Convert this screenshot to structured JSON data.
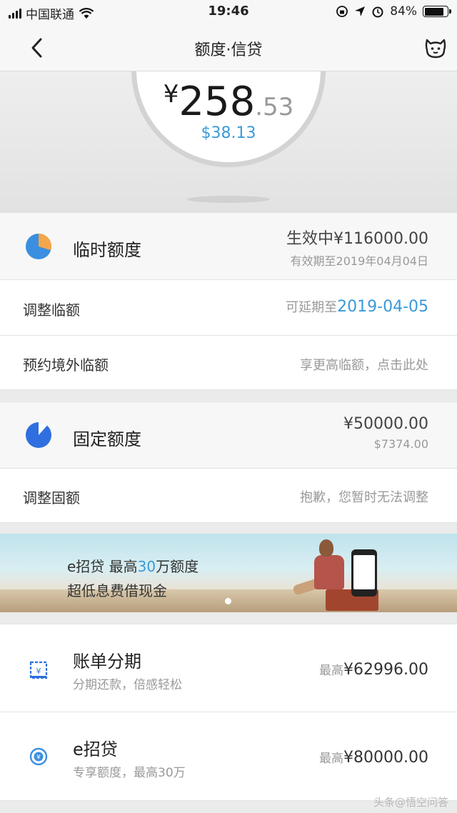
{
  "status_bar": {
    "carrier": "中国联通",
    "time": "19:46",
    "battery_percent": "84%",
    "battery_level": 0.84
  },
  "nav": {
    "title": "额度·信贷"
  },
  "hero": {
    "yen_symbol": "¥",
    "amount_int": "258",
    "amount_dec": ".53",
    "usd_amount": "$38.13"
  },
  "temporary_limit": {
    "label": "临时额度",
    "status_amount": "生效中¥116000.00",
    "validity": "有效期至2019年04月04日",
    "pie_color": "#3a8fe0",
    "pie_accent": "#f4a64a"
  },
  "adjust_temp": {
    "label": "调整临额",
    "hint_prefix": "可延期至",
    "hint_date": "2019-04-05"
  },
  "overseas_temp": {
    "label": "预约境外临额",
    "hint": "享更高临额，点击此处"
  },
  "fixed_limit": {
    "label": "固定额度",
    "amount": "¥50000.00",
    "usd": "$7374.00",
    "pie_color": "#2f6fe0"
  },
  "adjust_fixed": {
    "label": "调整固额",
    "hint": "抱歉，您暂时无法调整"
  },
  "banner": {
    "line1_prefix": "e招贷  最高",
    "line1_highlight": "30",
    "line1_suffix": "万额度",
    "line2": "超低息费借现金"
  },
  "products": [
    {
      "title": "账单分期",
      "subtitle": "分期还款，倍感轻松",
      "prefix": "最高",
      "amount": "¥62996.00"
    },
    {
      "title": "e招贷",
      "subtitle": "专享额度，最高30万",
      "prefix": "最高",
      "amount": "¥80000.00"
    }
  ],
  "watermark": "头条@悟空问答",
  "colors": {
    "accent": "#3a9ad9"
  }
}
